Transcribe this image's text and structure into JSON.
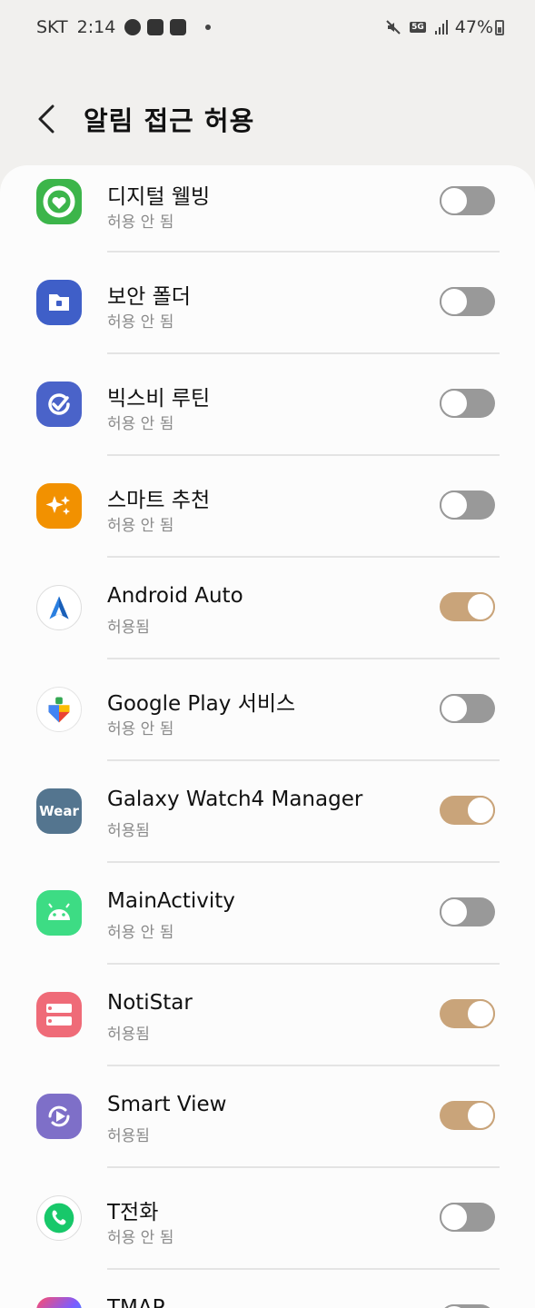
{
  "status_bar": {
    "carrier": "SKT",
    "time": "2:14",
    "battery": "47%",
    "network": "5G"
  },
  "header": {
    "title": "알림 접근 허용"
  },
  "apps": [
    {
      "name": "디지털 웰빙",
      "status": "허용 안 됨",
      "enabled": false,
      "icon": "digital-wellbeing-icon"
    },
    {
      "name": "보안 폴더",
      "status": "허용 안 됨",
      "enabled": false,
      "icon": "secure-folder-icon"
    },
    {
      "name": "빅스비 루틴",
      "status": "허용 안 됨",
      "enabled": false,
      "icon": "bixby-routines-icon"
    },
    {
      "name": "스마트 추천",
      "status": "허용 안 됨",
      "enabled": false,
      "icon": "smart-suggestions-icon"
    },
    {
      "name": "Android Auto",
      "status": "허용됨",
      "enabled": true,
      "icon": "android-auto-icon"
    },
    {
      "name": "Google Play 서비스",
      "status": "허용 안 됨",
      "enabled": false,
      "icon": "google-play-services-icon"
    },
    {
      "name": "Galaxy Watch4 Manager",
      "status": "허용됨",
      "enabled": true,
      "icon": "wear-icon"
    },
    {
      "name": "MainActivity",
      "status": "허용 안 됨",
      "enabled": false,
      "icon": "android-icon"
    },
    {
      "name": "NotiStar",
      "status": "허용됨",
      "enabled": true,
      "icon": "notistar-icon"
    },
    {
      "name": "Smart View",
      "status": "허용됨",
      "enabled": true,
      "icon": "smart-view-icon"
    },
    {
      "name": "T전화",
      "status": "허용 안 됨",
      "enabled": false,
      "icon": "t-phone-icon"
    },
    {
      "name": "TMAP",
      "status": "",
      "enabled": false,
      "icon": "tmap-icon"
    }
  ],
  "icon_labels": {
    "wear": "Wear"
  },
  "colors": {
    "toggle_on": "#c9a47a",
    "toggle_off": "#999999"
  }
}
